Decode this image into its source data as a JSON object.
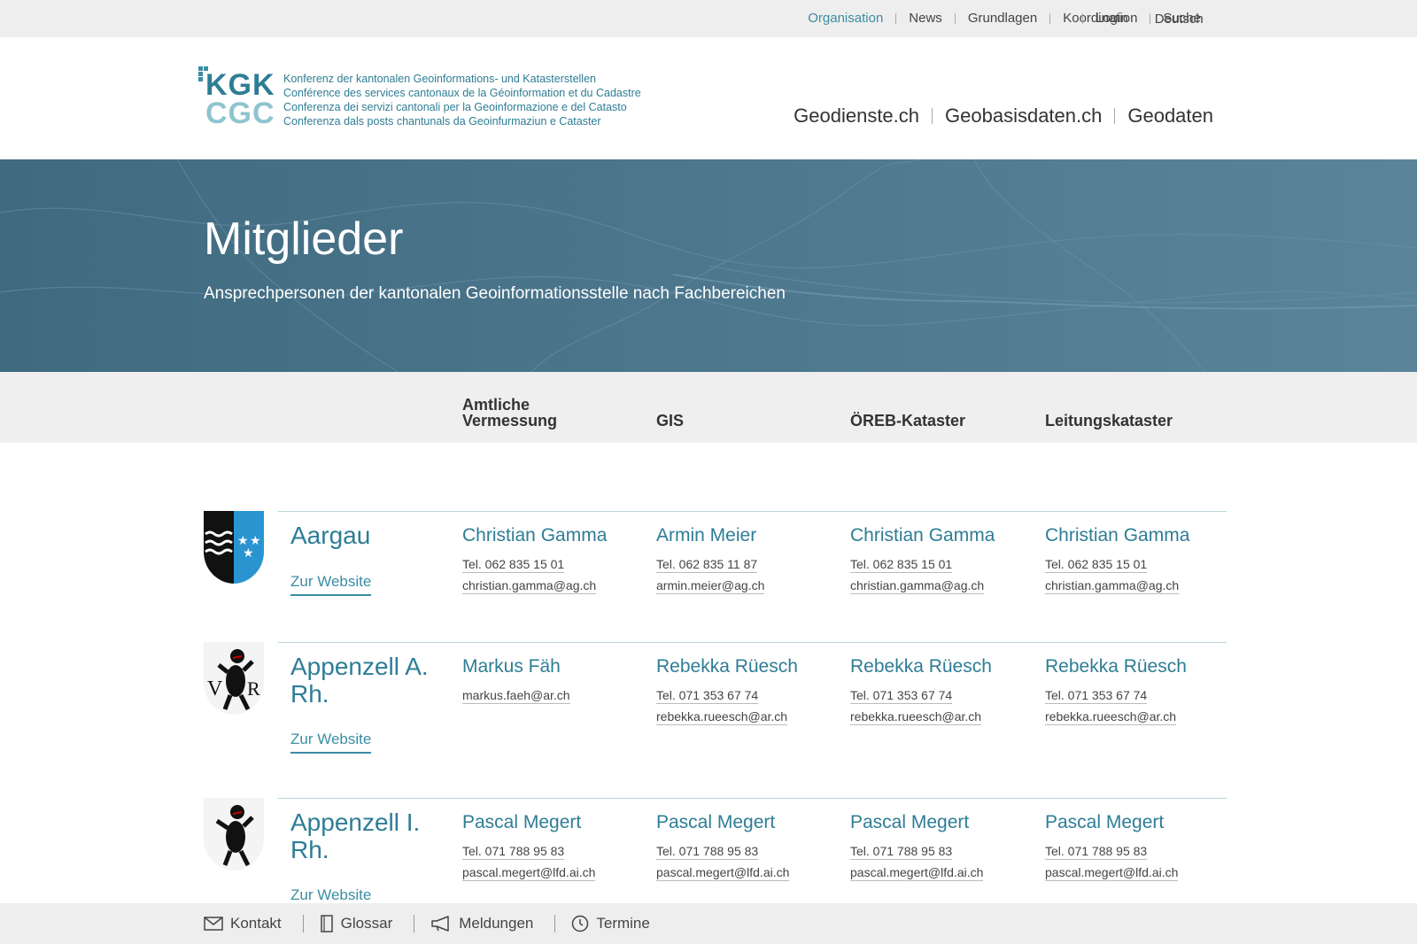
{
  "topnav": {
    "items": [
      "Organisation",
      "News",
      "Grundlagen",
      "Koordination",
      "Suche"
    ],
    "login": "Login",
    "language": "Deutsch"
  },
  "logo": {
    "kgk": "KGK",
    "cgc": "CGC",
    "lines": [
      "Konferenz der kantonalen Geoinformations- und Katasterstellen",
      "Conférence des services cantonaux de la Géoinformation et du Cadastre",
      "Conferenza dei servizi cantonali per la Geoinformazione e del Catasto",
      "Conferenza dals posts chantunals da Geoinfurmaziun e Cataster"
    ]
  },
  "mainnav": [
    "Geodienste.ch",
    "Geobasisdaten.ch",
    "Geodaten"
  ],
  "hero": {
    "title": "Mitglieder",
    "subtitle": "Ansprechpersonen der kantonalen Geoinformationsstelle nach Fachbereichen"
  },
  "columns": [
    "Amtliche\nVermessung",
    "GIS",
    "ÖREB-Kataster",
    "Leitungskataster"
  ],
  "rows": [
    {
      "canton": "Aargau",
      "website": "Zur Website",
      "contacts": [
        {
          "name": "Christian Gamma",
          "tel": "Tel. 062 835 15 01",
          "email": "christian.gamma@ag.ch"
        },
        {
          "name": "Armin Meier",
          "tel": "Tel. 062 835 11 87",
          "email": "armin.meier@ag.ch"
        },
        {
          "name": "Christian Gamma",
          "tel": "Tel. 062 835 15 01",
          "email": "christian.gamma@ag.ch"
        },
        {
          "name": "Christian Gamma",
          "tel": "Tel. 062 835 15 01",
          "email": "christian.gamma@ag.ch"
        }
      ]
    },
    {
      "canton": "Appenzell A. Rh.",
      "website": "Zur Website",
      "contacts": [
        {
          "name": "Markus Fäh",
          "email": "markus.faeh@ar.ch"
        },
        {
          "name": "Rebekka Rüesch",
          "tel": "Tel. 071 353 67 74",
          "email": "rebekka.rueesch@ar.ch"
        },
        {
          "name": "Rebekka Rüesch",
          "tel": "Tel. 071 353 67 74",
          "email": "rebekka.rueesch@ar.ch"
        },
        {
          "name": "Rebekka Rüesch",
          "tel": "Tel. 071 353 67 74",
          "email": "rebekka.rueesch@ar.ch"
        }
      ]
    },
    {
      "canton": "Appenzell I. Rh.",
      "website": "Zur Website",
      "contacts": [
        {
          "name": "Pascal Megert",
          "tel": "Tel. 071 788 95 83",
          "email": "pascal.megert@lfd.ai.ch"
        },
        {
          "name": "Pascal Megert",
          "tel": "Tel. 071 788 95 83",
          "email": "pascal.megert@lfd.ai.ch"
        },
        {
          "name": "Pascal Megert",
          "tel": "Tel. 071 788 95 83",
          "email": "pascal.megert@lfd.ai.ch"
        },
        {
          "name": "Pascal Megert",
          "tel": "Tel. 071 788 95 83",
          "email": "pascal.megert@lfd.ai.ch"
        }
      ]
    }
  ],
  "bottombar": [
    "Kontakt",
    "Glossar",
    "Meldungen",
    "Termine"
  ],
  "icons": {
    "bottombar": [
      "envelope-icon",
      "book-icon",
      "megaphone-icon",
      "clock-icon"
    ],
    "shields": [
      "aargau-coat-of-arms-icon",
      "appenzell-ar-coat-of-arms-icon",
      "appenzell-ir-coat-of-arms-icon"
    ]
  },
  "colors": {
    "accent": "#3a8ea3",
    "brand_dark": "#2e7d95",
    "brand_light": "#8fc4cf",
    "hero": "#4a7489",
    "aargau_blue": "#2a94d1"
  }
}
